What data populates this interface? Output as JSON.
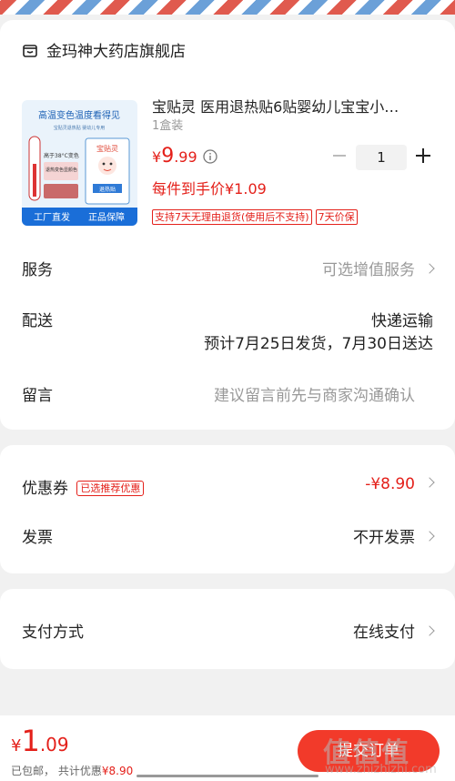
{
  "shop": {
    "name": "金玛神大药店旗舰店",
    "icon": "shop-icon"
  },
  "product": {
    "title": "宝贴灵 医用退热贴6贴婴幼儿宝宝小…",
    "spec": "1盒装",
    "price_currency": "¥",
    "price_int": "9",
    "price_dec": ".99",
    "quantity": "1",
    "arrival_price": "每件到手价¥1.09",
    "tags": [
      "支持7天无理由退货(使用后不支持)",
      "7天价保"
    ],
    "thumb_text": {
      "headline": "高温变色温度看得见",
      "sub": "宝贴灵退热贴 婴幼儿专用",
      "brand": "宝贴灵",
      "temp": "高于38°C变色",
      "label": "退热贴",
      "note": "退热变色显颜色",
      "footer_left": "工厂直发",
      "footer_right": "正品保障"
    }
  },
  "rows": {
    "service": {
      "label": "服务",
      "value": "可选增值服务"
    },
    "delivery": {
      "label": "配送",
      "method": "快递运输",
      "eta": "预计7月25日发货，7月30日送达"
    },
    "message": {
      "label": "留言",
      "placeholder": "建议留言前先与商家沟通确认"
    },
    "coupon": {
      "label": "优惠券",
      "tag": "已选推荐优惠",
      "value": "-¥8.90"
    },
    "invoice": {
      "label": "发票",
      "value": "不开发票"
    },
    "payment": {
      "label": "支付方式",
      "value": "在线支付"
    }
  },
  "bottom": {
    "total_currency": "¥",
    "total_int": "1",
    "total_dec": ".09",
    "shipping": "已包邮",
    "discount_prefix": "共计优惠",
    "discount_value": "¥8.90",
    "submit": "提交订单"
  },
  "watermark": {
    "logo": "值值值",
    "url": "www.zhizhizhi.com"
  },
  "colors": {
    "accent": "#e4201a",
    "button": "#f23a2a",
    "background": "#f1f1f1"
  }
}
